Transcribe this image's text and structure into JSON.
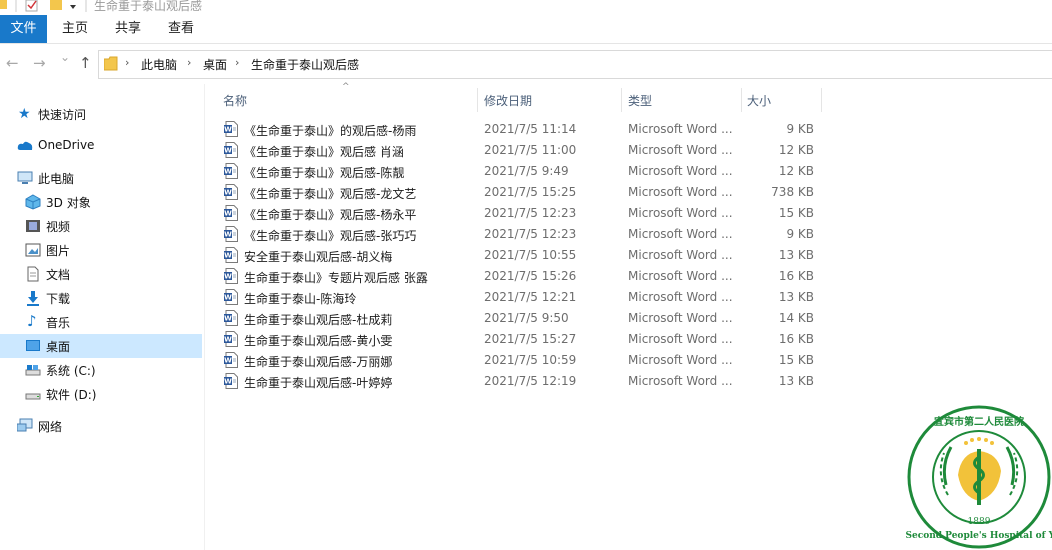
{
  "window": {
    "title": "生命重于泰山观后感"
  },
  "ribbon": {
    "tabs": [
      "文件",
      "主页",
      "共享",
      "查看"
    ]
  },
  "nav": {
    "back": "←",
    "forward": "→",
    "dropdown": "⌄",
    "up": "↑"
  },
  "address": {
    "crumbs": [
      "此电脑",
      "桌面",
      "生命重于泰山观后感"
    ]
  },
  "sidebar": {
    "items": [
      {
        "label": "快速访问",
        "icon": "star-icon"
      },
      {
        "label": "OneDrive",
        "icon": "cloud-icon"
      },
      {
        "label": "此电脑",
        "icon": "computer-icon"
      },
      {
        "label": "3D 对象",
        "icon": "cube-icon"
      },
      {
        "label": "视频",
        "icon": "video-icon"
      },
      {
        "label": "图片",
        "icon": "picture-icon"
      },
      {
        "label": "文档",
        "icon": "document-icon"
      },
      {
        "label": "下载",
        "icon": "download-icon"
      },
      {
        "label": "音乐",
        "icon": "music-icon"
      },
      {
        "label": "桌面",
        "icon": "desktop-icon"
      },
      {
        "label": "系统 (C:)",
        "icon": "drive-c-icon"
      },
      {
        "label": "软件 (D:)",
        "icon": "drive-d-icon"
      },
      {
        "label": "网络",
        "icon": "network-icon"
      }
    ]
  },
  "columns": {
    "name": "名称",
    "date": "修改日期",
    "type": "类型",
    "size": "大小",
    "sort_indicator": "^"
  },
  "files": [
    {
      "name": "《生命重于泰山》的观后感-杨雨",
      "date": "2021/7/5 11:14",
      "type": "Microsoft Word ...",
      "size": "9 KB"
    },
    {
      "name": "《生命重于泰山》观后感  肖涵",
      "date": "2021/7/5 11:00",
      "type": "Microsoft Word ...",
      "size": "12 KB"
    },
    {
      "name": "《生命重于泰山》观后感-陈靓",
      "date": "2021/7/5 9:49",
      "type": "Microsoft Word ...",
      "size": "12 KB"
    },
    {
      "name": "《生命重于泰山》观后感-龙文艺",
      "date": "2021/7/5 15:25",
      "type": "Microsoft Word ...",
      "size": "738 KB"
    },
    {
      "name": "《生命重于泰山》观后感-杨永平",
      "date": "2021/7/5 12:23",
      "type": "Microsoft Word ...",
      "size": "15 KB"
    },
    {
      "name": "《生命重于泰山》观后感-张巧巧",
      "date": "2021/7/5 12:23",
      "type": "Microsoft Word ...",
      "size": "9 KB"
    },
    {
      "name": "安全重于泰山观后感-胡义梅",
      "date": "2021/7/5 10:55",
      "type": "Microsoft Word ...",
      "size": "13 KB"
    },
    {
      "name": "生命重于泰山》专题片观后感 张露",
      "date": "2021/7/5 15:26",
      "type": "Microsoft Word ...",
      "size": "16 KB"
    },
    {
      "name": "生命重于泰山-陈海玲",
      "date": "2021/7/5 12:21",
      "type": "Microsoft Word ...",
      "size": "13 KB"
    },
    {
      "name": "生命重于泰山观后感-杜成莉",
      "date": "2021/7/5 9:50",
      "type": "Microsoft Word ...",
      "size": "14 KB"
    },
    {
      "name": "生命重于泰山观后感-黄小雯",
      "date": "2021/7/5 15:27",
      "type": "Microsoft Word ...",
      "size": "16 KB"
    },
    {
      "name": "生命重于泰山观后感-万丽娜",
      "date": "2021/7/5 10:59",
      "type": "Microsoft Word ...",
      "size": "15 KB"
    },
    {
      "name": "生命重于泰山观后感-叶婷婷",
      "date": "2021/7/5 12:19",
      "type": "Microsoft Word ...",
      "size": "13 KB"
    }
  ],
  "seal": {
    "text": "宜宾市第二人民医院 The Second People's Hospital of Yibin",
    "year": "1889"
  },
  "colors": {
    "accent": "#1979ca",
    "selected": "#cce8ff",
    "seal_green": "#1e8a3a",
    "seal_gold": "#f2c23a",
    "word_blue": "#2b579a"
  }
}
